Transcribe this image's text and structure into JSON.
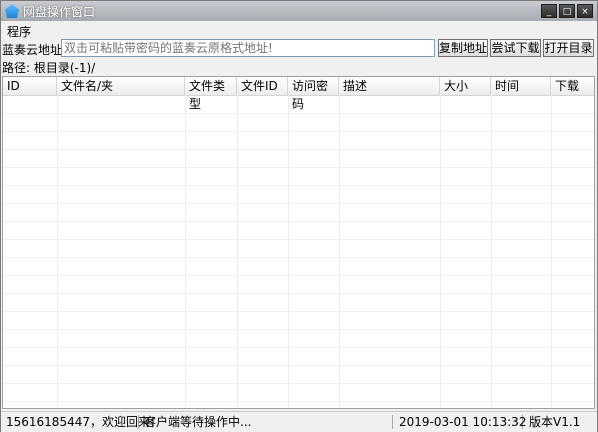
{
  "window": {
    "title": "网盘操作窗口",
    "buttons": {
      "minimize": "_",
      "maximize": "□",
      "close": "×"
    }
  },
  "menu": {
    "items": [
      "程序"
    ]
  },
  "address": {
    "label": "蓝奏云地址:",
    "placeholder": "双击可粘贴带密码的蓝奏云原格式地址!",
    "copy_button": "复制地址",
    "download_button": "尝试下载",
    "open_dir_button": "打开目录"
  },
  "path": {
    "text": "路径: 根目录(-1)/"
  },
  "table": {
    "columns": [
      "ID",
      "文件名/夹",
      "文件类型",
      "文件ID",
      "访问密码",
      "描述",
      "大小",
      "时间",
      "下载"
    ]
  },
  "status": {
    "user": "15616185447，欢迎回来！",
    "message": "客户端等待操作中...",
    "datetime": "2019-03-01 10:13:32",
    "version": "版本V1.1"
  }
}
